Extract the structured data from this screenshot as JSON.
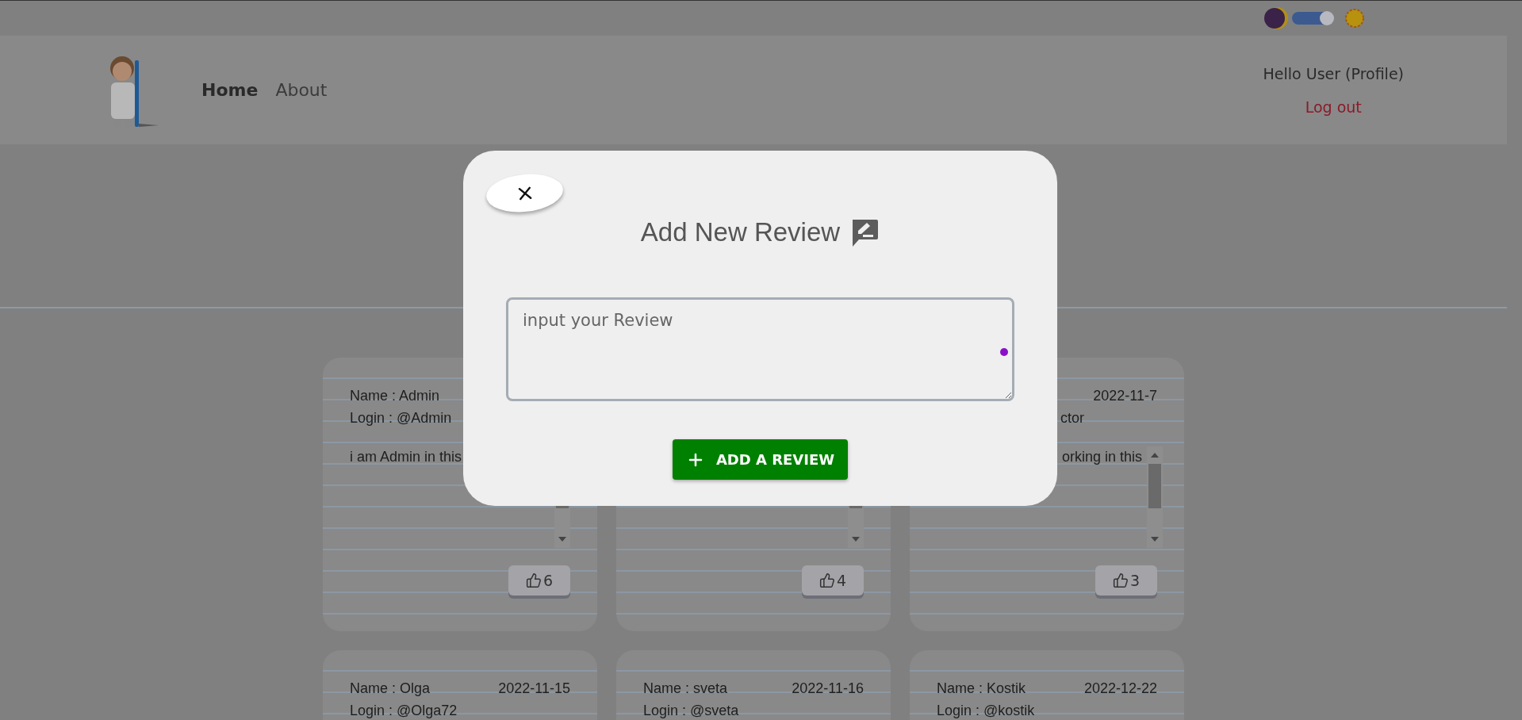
{
  "theme_toggle": {
    "on": true
  },
  "nav": {
    "links": [
      {
        "label": "Home",
        "selected": true
      },
      {
        "label": "About",
        "selected": false
      }
    ]
  },
  "user": {
    "greeting": "Hello User (Profile)",
    "logout": "Log out"
  },
  "reviews": [
    {
      "name": "Name : Admin",
      "login": "Login : @Admin",
      "text": "i am Admin in this",
      "likes": "6"
    },
    {
      "likes": "4"
    },
    {
      "login": "ctor",
      "date": "2022-11-7",
      "text": "orking in this",
      "likes": "3"
    },
    {
      "name": "Name : Olga",
      "login": "Login : @Olga72",
      "date": "2022-11-15"
    },
    {
      "name": "Name : sveta",
      "login": "Login : @sveta",
      "date": "2022-11-16"
    },
    {
      "name": "Name : Kostik",
      "login": "Login : @kostik",
      "date": "2022-12-22"
    }
  ],
  "modal": {
    "title": "Add New Review",
    "placeholder": "input your Review",
    "submit": "ADD A REVIEW"
  }
}
